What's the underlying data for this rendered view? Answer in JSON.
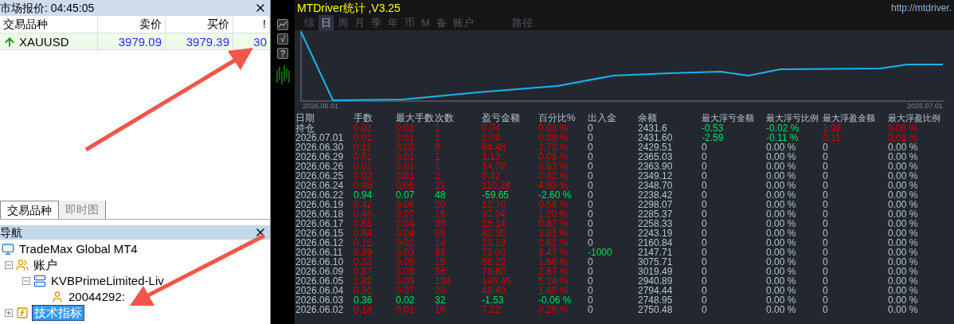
{
  "market_watch": {
    "title": "市场报价: 04:45:05",
    "columns": [
      "交易品种",
      "卖价",
      "买价",
      "!"
    ],
    "rows": [
      {
        "symbol": "XAUUSD",
        "bid": "3979.09",
        "ask": "3979.39",
        "spread": "30"
      }
    ],
    "tabs": [
      {
        "label": "交易品种",
        "selected": true
      },
      {
        "label": "即时图",
        "selected": false
      }
    ]
  },
  "navigator": {
    "title": "导航",
    "tree": [
      {
        "label": "TradeMax Global MT4",
        "kind": "terminal",
        "selected": false,
        "children": [
          {
            "label": "账户",
            "kind": "accounts",
            "expanded": true,
            "selected": false,
            "children": [
              {
                "label": "KVBPrimeLimited-Liv",
                "kind": "server",
                "expanded": true,
                "selected": false,
                "children": [
                  {
                    "label": "20044292:",
                    "kind": "user",
                    "selected": false
                  }
                ]
              }
            ]
          },
          {
            "label": "技术指标",
            "kind": "indicators",
            "expanded": false,
            "selected": true
          }
        ]
      }
    ]
  },
  "chart_toolbar": {
    "buttons": [
      "√",
      "?"
    ]
  },
  "stats": {
    "title": "MTDriver统计 ,V3.25",
    "url": "http://mtdriver.",
    "tabs": [
      {
        "label": "综",
        "selected": false
      },
      {
        "label": "日",
        "selected": true
      },
      {
        "label": "周",
        "selected": false
      },
      {
        "label": "月",
        "selected": false
      },
      {
        "label": "季",
        "selected": false
      },
      {
        "label": "年",
        "selected": false
      },
      {
        "label": "币",
        "selected": false
      },
      {
        "label": "M",
        "selected": false
      },
      {
        "label": "备",
        "selected": false
      },
      {
        "label": "账户",
        "selected": false
      },
      {
        "label": "路径",
        "selected": false
      }
    ],
    "chart": {
      "x_start_label": "2026.06.01",
      "x_end_label": "2026.07.01"
    },
    "columns": [
      "日期",
      "手数",
      "最大手数",
      "次数",
      "盈亏金额",
      "百分比%",
      "出入金",
      "余额",
      "最大浮亏金额",
      "最大浮亏比例",
      "最大浮盈金额",
      "最大浮盈比例"
    ],
    "rows": [
      {
        "cells": [
          "持仓",
          "0.01",
          "0.01",
          "1",
          "0.74",
          "0.03 %",
          "0",
          "2431.6",
          "-0.53",
          "-0.02 %",
          "1.98",
          "0.08 %"
        ],
        "profit": true,
        "cash_flow": false,
        "floating": true
      },
      {
        "cells": [
          "2026.07.01",
          "0.01",
          "0.01",
          "1",
          "2.09",
          "0.09 %",
          "0",
          "2431.60",
          "-2.59",
          "-0.11 %",
          "0.11",
          "0.01 %"
        ],
        "profit": true,
        "cash_flow": false,
        "floating": true
      },
      {
        "cells": [
          "2026.06.30",
          "0.11",
          "0.02",
          "9",
          "64.48",
          "2.73 %",
          "0",
          "2429.51",
          "0",
          "0.00 %",
          "0",
          "0.00 %"
        ],
        "profit": true,
        "cash_flow": false,
        "floating": false
      },
      {
        "cells": [
          "2026.06.29",
          "0.01",
          "0.01",
          "1",
          "1.13",
          "0.05 %",
          "0",
          "2365.03",
          "0",
          "0.00 %",
          "0",
          "0.00 %"
        ],
        "profit": true,
        "cash_flow": false,
        "floating": false
      },
      {
        "cells": [
          "2026.06.26",
          "0.01",
          "0.01",
          "1",
          "14.78",
          "0.63 %",
          "0",
          "2363.90",
          "0",
          "0.00 %",
          "0",
          "0.00 %"
        ],
        "profit": true,
        "cash_flow": false,
        "floating": false
      },
      {
        "cells": [
          "2026.06.25",
          "0.02",
          "0.01",
          "2",
          "0.42",
          "0.02 %",
          "0",
          "2349.12",
          "0",
          "0.00 %",
          "0",
          "0.00 %"
        ],
        "profit": true,
        "cash_flow": false,
        "floating": false
      },
      {
        "cells": [
          "2026.06.24",
          "0.48",
          "0.06",
          "21",
          "110.28",
          "4.93 %",
          "0",
          "2348.70",
          "0",
          "0.00 %",
          "0",
          "0.00 %"
        ],
        "profit": true,
        "cash_flow": false,
        "floating": false
      },
      {
        "cells": [
          "2026.06.22",
          "0.94",
          "0.07",
          "48",
          "-59.65",
          "-2.60 %",
          "0",
          "2238.42",
          "0",
          "0.00 %",
          "0",
          "0.00 %"
        ],
        "profit": false,
        "cash_flow": false,
        "floating": false
      },
      {
        "cells": [
          "2026.06.19",
          "0.42",
          "0.06",
          "20",
          "12.70",
          "0.56 %",
          "0",
          "2298.07",
          "0",
          "0.00 %",
          "0",
          "0.00 %"
        ],
        "profit": true,
        "cash_flow": false,
        "floating": false
      },
      {
        "cells": [
          "2026.06.18",
          "0.46",
          "0.07",
          "16",
          "27.04",
          "1.20 %",
          "0",
          "2285.37",
          "0",
          "0.00 %",
          "0",
          "0.00 %"
        ],
        "profit": true,
        "cash_flow": false,
        "floating": false
      },
      {
        "cells": [
          "2026.06.17",
          "0.68",
          "0.04",
          "39",
          "15.14",
          "0.67 %",
          "0",
          "2258.33",
          "0",
          "0.00 %",
          "0",
          "0.00 %"
        ],
        "profit": true,
        "cash_flow": false,
        "floating": false
      },
      {
        "cells": [
          "2026.06.15",
          "0.94",
          "0.04",
          "66",
          "82.35",
          "3.81 %",
          "0",
          "2243.19",
          "0",
          "0.00 %",
          "0",
          "0.00 %"
        ],
        "profit": true,
        "cash_flow": false,
        "floating": false
      },
      {
        "cells": [
          "2026.06.12",
          "0.15",
          "0.02",
          "14",
          "13.13",
          "0.61 %",
          "0",
          "2160.84",
          "0",
          "0.00 %",
          "0",
          "0.00 %"
        ],
        "profit": true,
        "cash_flow": false,
        "floating": false
      },
      {
        "cells": [
          "2026.06.11",
          "0.99",
          "0.03",
          "83",
          "72.00",
          "3.47 %",
          "-1000",
          "2147.71",
          "0",
          "0.00 %",
          "0",
          "0.00 %"
        ],
        "profit": true,
        "cash_flow": true,
        "floating": false
      },
      {
        "cells": [
          "2026.06.10",
          "0.33",
          "0.05",
          "15",
          "56.22",
          "1.86 %",
          "0",
          "3075.71",
          "0",
          "0.00 %",
          "0",
          "0.00 %"
        ],
        "profit": true,
        "cash_flow": false,
        "floating": false
      },
      {
        "cells": [
          "2026.06.09",
          "0.87",
          "0.05",
          "56",
          "78.60",
          "2.67 %",
          "0",
          "3019.49",
          "0",
          "0.00 %",
          "0",
          "0.00 %"
        ],
        "profit": true,
        "cash_flow": false,
        "floating": false
      },
      {
        "cells": [
          "2026.06.05",
          "1.89",
          "0.05",
          "134",
          "146.45",
          "5.24 %",
          "0",
          "2940.89",
          "0",
          "0.00 %",
          "0",
          "0.00 %"
        ],
        "profit": true,
        "cash_flow": false,
        "floating": false
      },
      {
        "cells": [
          "2026.06.04",
          "0.50",
          "0.07",
          "20",
          "45.49",
          "1.65 %",
          "0",
          "2794.44",
          "0",
          "0.00 %",
          "0",
          "0.00 %"
        ],
        "profit": true,
        "cash_flow": false,
        "floating": false
      },
      {
        "cells": [
          "2026.06.03",
          "0.36",
          "0.02",
          "32",
          "-1.53",
          "-0.06 %",
          "0",
          "2748.95",
          "0",
          "0.00 %",
          "0",
          "0.00 %"
        ],
        "profit": false,
        "cash_flow": false,
        "floating": false
      },
      {
        "cells": [
          "2026.06.02",
          "0.16",
          "0.01",
          "16",
          "7.22",
          "0.26 %",
          "0",
          "2750.48",
          "0",
          "0.00 %",
          "0",
          "0.00 %"
        ],
        "profit": true,
        "cash_flow": false,
        "floating": false
      }
    ]
  }
}
